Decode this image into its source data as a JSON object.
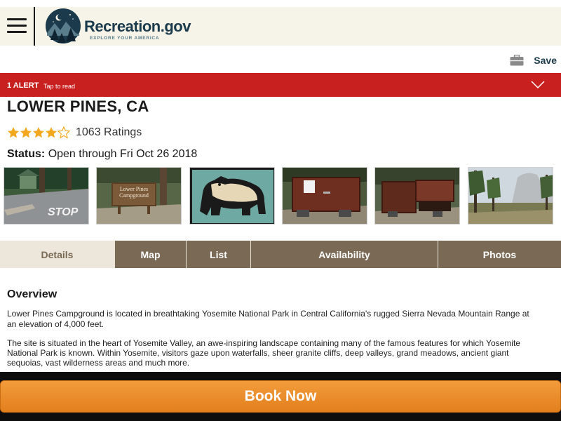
{
  "header": {
    "logo_name": "Recreation.gov",
    "logo_tagline": "EXPLORE YOUR AMERICA"
  },
  "actions": {
    "save_label": "Save"
  },
  "alert": {
    "count_label": "1 ALERT",
    "hint": "Tap to read"
  },
  "campground": {
    "title": "LOWER PINES, CA",
    "rating_value": 4.5,
    "rating_text": "1063 Ratings",
    "status_label": "Status:",
    "status_value": "Open through Fri Oct 26 2018"
  },
  "gallery": {
    "photos": [
      "entrance-stop-sign",
      "lower-pines-campground-sign",
      "bear-warning-sign",
      "bear-food-locker",
      "bear-food-locker-open",
      "half-dome-meadow"
    ],
    "sign_text": "Lower Pines Campground",
    "road_text": "STOP"
  },
  "tabs": [
    "Details",
    "Map",
    "List",
    "Availability",
    "Photos"
  ],
  "overview": {
    "title": "Overview",
    "p1": "Lower Pines Campground is located in breathtaking Yosemite National Park in Central California's rugged Sierra Nevada Mountain Range at an elevation of 4,000 feet.",
    "p2": "The site is situated in the heart of Yosemite Valley, an awe-inspiring landscape containing many of the famous features for which Yosemite National Park is known. Within Yosemite, visitors gaze upon waterfalls, sheer granite cliffs, deep valleys, grand meadows, ancient giant sequoias, vast wilderness areas and much more."
  },
  "book": {
    "label": "Book Now"
  },
  "colors": {
    "alert": "#c8201f",
    "tab_bg": "#7a6a55",
    "tab_active_bg": "#ece7da",
    "book": "#e8871f",
    "star": "#f3a81f",
    "header_bg": "#f6f4e8"
  }
}
